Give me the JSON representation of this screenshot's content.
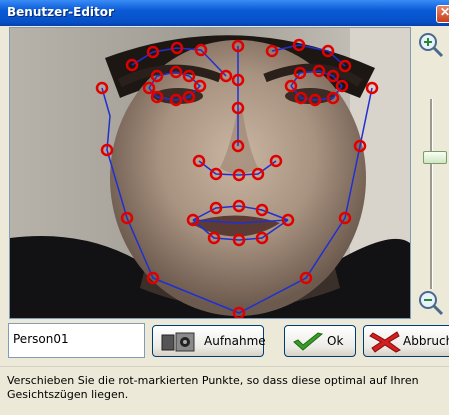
{
  "window": {
    "title": "Benutzer-Editor"
  },
  "editor": {
    "name_value": "Person01",
    "buttons": {
      "capture": "Aufnahme",
      "ok": "Ok",
      "cancel": "Abbruch"
    }
  },
  "status": {
    "text": "Verschieben Sie die rot-markierten Punkte, so dass diese optimal auf Ihren Gesichtszügen liegen."
  },
  "colors": {
    "landmark_point": "#e00000",
    "mesh_line": "#2030d0",
    "title_bar": "#0a5bd6"
  },
  "icons": [
    "close-icon",
    "zoom-in-icon",
    "zoom-out-icon",
    "camera-icon",
    "checkmark-icon",
    "cancel-x-icon"
  ]
}
